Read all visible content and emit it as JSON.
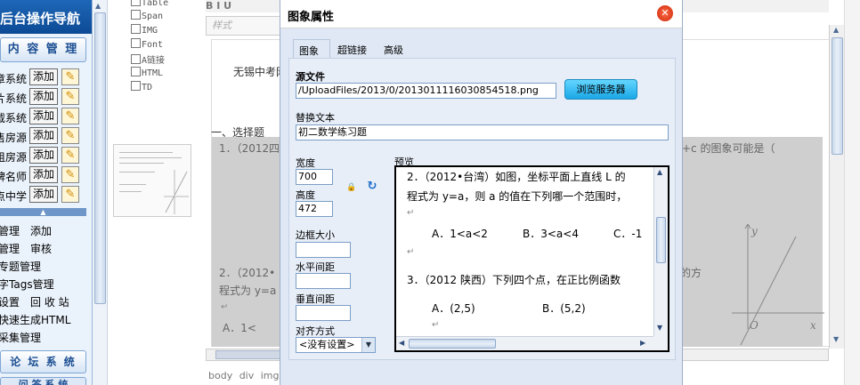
{
  "nav": {
    "title": "后台操作导航",
    "content_header": "内 容 管 理",
    "rows": [
      {
        "label": "章系统",
        "add": "添加"
      },
      {
        "label": "片系统",
        "add": "添加"
      },
      {
        "label": "载系统",
        "add": "添加"
      },
      {
        "label": "售房源",
        "add": "添加"
      },
      {
        "label": "租房源",
        "add": "添加"
      },
      {
        "label": "牌名师",
        "add": "添加"
      },
      {
        "label": "点中学",
        "add": "添加"
      }
    ],
    "links": [
      "管理　添加",
      "管理　审核",
      "专题管理",
      "字Tags管理",
      "设置　回 收 站",
      "快速生成HTML",
      "采集管理"
    ],
    "forum_header": "论 坛 系 统",
    "last_header": "问 答 系 统"
  },
  "tags": [
    "Table",
    "Span",
    "IMG",
    "Font",
    "A链接",
    "HTML",
    "TD"
  ],
  "editor": {
    "toolbar": "B  I  U",
    "style_placeholder": "样式",
    "text1": "无锡中考网",
    "h2": "一、选择题",
    "gray1": "1．（2012四",
    "gray_right1": "+c 的图象可能是（",
    "gray2": "2．（2012•",
    "gray3": "程式为 y=a",
    "gray4": "A．1<",
    "gray_right2": "的方",
    "path": "body div img"
  },
  "modal": {
    "title": "图象属性",
    "tabs": [
      "图象",
      "超链接",
      "高级"
    ],
    "src_label": "源文件",
    "src_value": "/UploadFiles/2013/0/2013011116030854518.png",
    "browse_label": "浏览服务器",
    "alt_label": "替换文本",
    "alt_value": "初二数学练习题",
    "width_label": "宽度",
    "width_value": "700",
    "height_label": "高度",
    "height_value": "472",
    "border_label": "边框大小",
    "border_value": "",
    "hspace_label": "水平间距",
    "hspace_value": "",
    "vspace_label": "垂直间距",
    "vspace_value": "",
    "align_label": "对齐方式",
    "align_value": "<没有设置>",
    "preview_label": "预览",
    "preview": {
      "line1": "2．（2012•台湾）如图，坐标平面上直线 L 的",
      "line2": "程式为 y=a，则 a 的值在下列哪一个范围时，",
      "opt_a": "A．1<a<2",
      "opt_b": "B．3<a<4",
      "opt_c": "C．-1",
      "line3": "3．（2012 陕西）下列四个点，在正比例函数",
      "opt_a2": "A．(2,5)",
      "opt_b2": "B．(5,2)"
    }
  }
}
